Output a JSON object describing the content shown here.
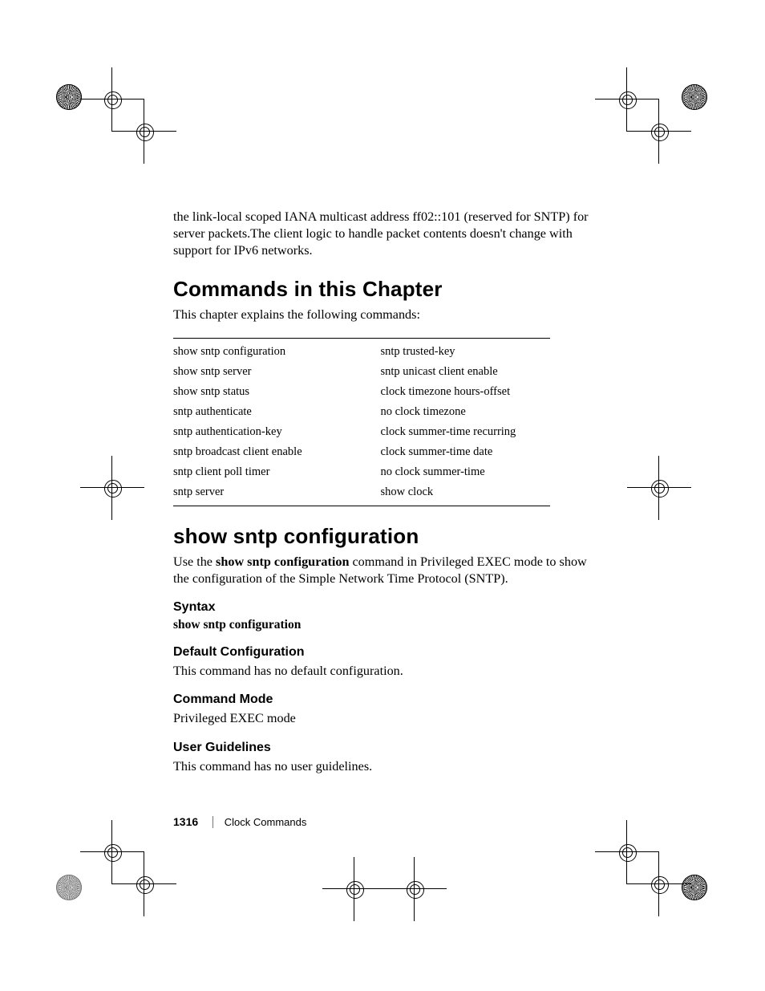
{
  "intro_paragraph": "the link-local scoped IANA multicast address ff02::101 (reserved for SNTP) for server packets.The client logic to handle packet contents doesn't change with support for IPv6 networks.",
  "section1": {
    "heading": "Commands in this Chapter",
    "lead": "This chapter explains the following commands:",
    "table": [
      {
        "c1": "show sntp configuration",
        "c2": "sntp trusted-key"
      },
      {
        "c1": "show sntp server",
        "c2": "sntp unicast client enable"
      },
      {
        "c1": "show sntp status",
        "c2": "clock timezone hours-offset"
      },
      {
        "c1": "sntp authenticate",
        "c2": "no clock timezone"
      },
      {
        "c1": "sntp authentication-key",
        "c2": "clock summer-time recurring"
      },
      {
        "c1": "sntp broadcast client enable",
        "c2": "clock summer-time date"
      },
      {
        "c1": "sntp client poll timer",
        "c2": "no clock summer-time"
      },
      {
        "c1": "sntp server",
        "c2": "show clock"
      }
    ]
  },
  "section2": {
    "heading": "show sntp configuration",
    "lead_pre": "Use the ",
    "lead_cmd": "show sntp configuration",
    "lead_post": " command in Privileged EXEC mode to show the configuration of the Simple Network Time Protocol (SNTP).",
    "syntax_h": "Syntax",
    "syntax_cmd": "show sntp configuration",
    "default_h": "Default Configuration",
    "default_body": "This command has no default configuration.",
    "mode_h": "Command Mode",
    "mode_body": "Privileged EXEC mode",
    "guide_h": "User Guidelines",
    "guide_body": "This command has no user guidelines."
  },
  "footer": {
    "page_number": "1316",
    "chapter": "Clock Commands"
  }
}
